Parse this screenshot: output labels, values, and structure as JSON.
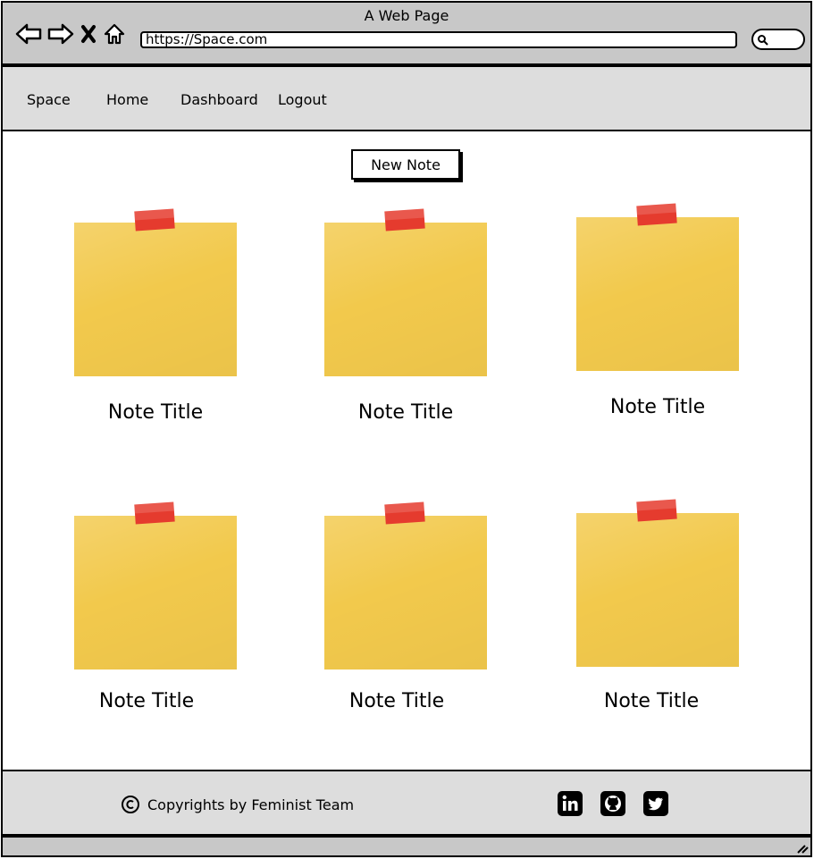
{
  "browser": {
    "window_title": "A Web Page",
    "url": "https://Space.com",
    "icons": [
      "back-arrow-icon",
      "forward-arrow-icon",
      "close-x-icon",
      "home-icon",
      "search-icon"
    ]
  },
  "nav": {
    "brand": "Space",
    "links": [
      "Home",
      "Dashboard",
      "Logout"
    ]
  },
  "main": {
    "new_note_label": "New Note",
    "notes": [
      {
        "title": "Note Title"
      },
      {
        "title": "Note Title"
      },
      {
        "title": "Note Title"
      },
      {
        "title": "Note Title"
      },
      {
        "title": "Note Title"
      },
      {
        "title": "Note Title"
      }
    ]
  },
  "footer": {
    "copyright_text": "Copyrights by Feminist Team",
    "social_icons": [
      "linkedin-icon",
      "github-icon",
      "twitter-icon"
    ]
  },
  "colors": {
    "sticky_note": "#f2c94c",
    "tape": "#e53b2e",
    "chrome": "#c8c8c8",
    "nav_background": "#dddddd"
  }
}
